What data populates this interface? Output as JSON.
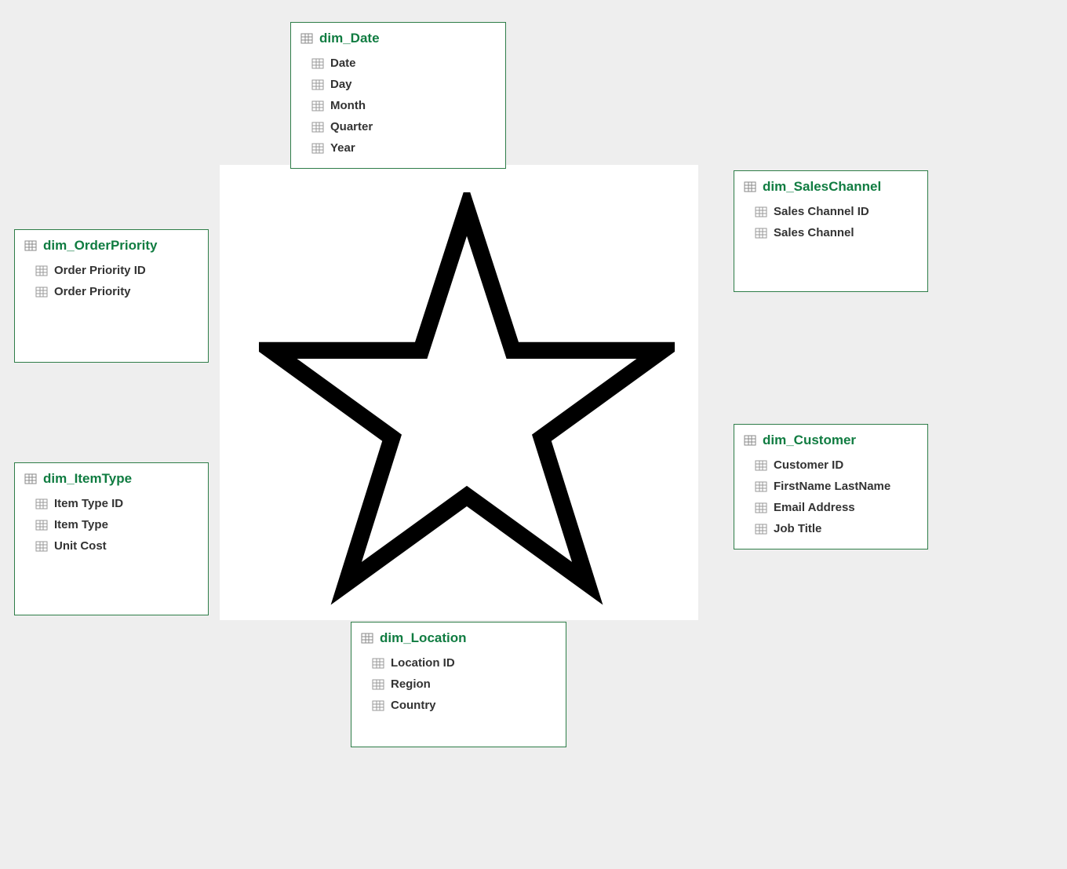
{
  "tables": {
    "date": {
      "name": "dim_Date",
      "fields": [
        "Date",
        "Day",
        "Month",
        "Quarter",
        "Year"
      ]
    },
    "orderPriority": {
      "name": "dim_OrderPriority",
      "fields": [
        "Order Priority ID",
        "Order Priority"
      ]
    },
    "itemType": {
      "name": "dim_ItemType",
      "fields": [
        "Item Type ID",
        "Item Type",
        "Unit Cost"
      ]
    },
    "salesChannel": {
      "name": "dim_SalesChannel",
      "fields": [
        "Sales Channel ID",
        "Sales Channel"
      ]
    },
    "customer": {
      "name": "dim_Customer",
      "fields": [
        "Customer ID",
        "FirstName LastName",
        "Email Address",
        "Job Title"
      ]
    },
    "location": {
      "name": "dim_Location",
      "fields": [
        "Location ID",
        "Region",
        "Country"
      ]
    }
  }
}
